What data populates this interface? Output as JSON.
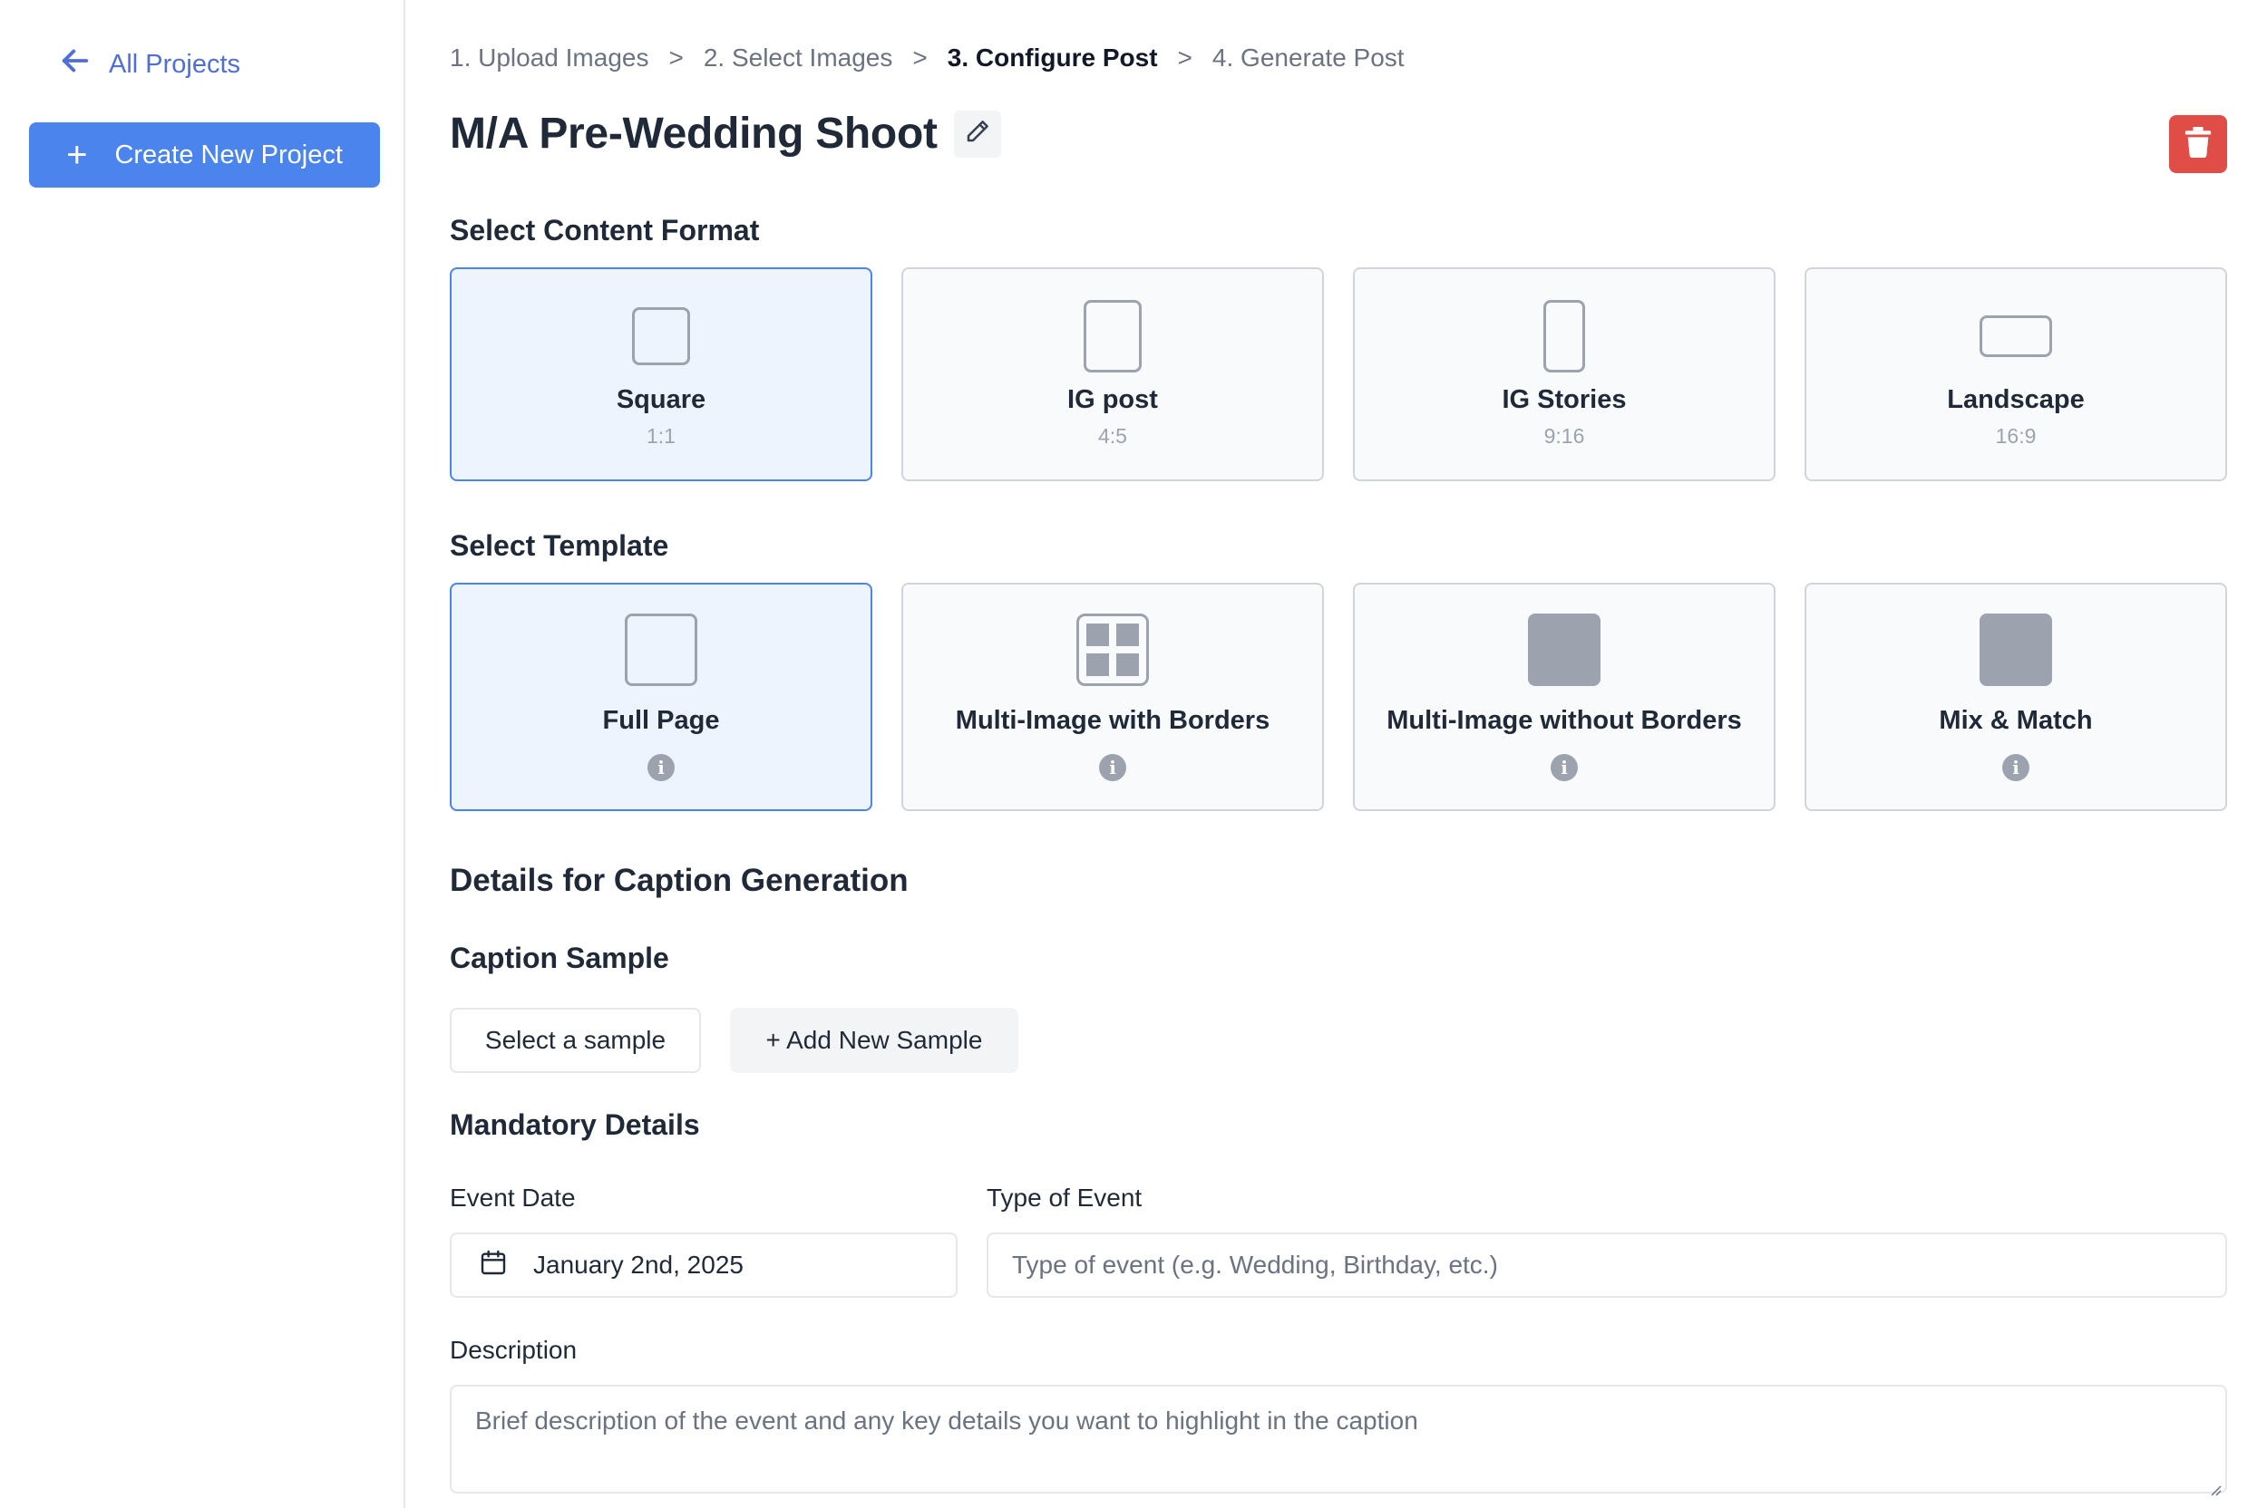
{
  "sidebar": {
    "back_label": "All Projects",
    "create_label": "Create New Project"
  },
  "breadcrumb": {
    "steps": [
      "1. Upload Images",
      "2. Select Images",
      "3. Configure Post",
      "4. Generate Post"
    ],
    "separator": ">",
    "active_index": 2
  },
  "project": {
    "title": "M/A Pre-Wedding Shoot"
  },
  "content_format": {
    "label": "Select Content Format",
    "options": [
      {
        "name": "Square",
        "ratio": "1:1",
        "selected": true
      },
      {
        "name": "IG post",
        "ratio": "4:5",
        "selected": false
      },
      {
        "name": "IG Stories",
        "ratio": "9:16",
        "selected": false
      },
      {
        "name": "Landscape",
        "ratio": "16:9",
        "selected": false
      }
    ]
  },
  "template": {
    "label": "Select Template",
    "options": [
      {
        "name": "Full Page",
        "selected": true
      },
      {
        "name": "Multi-Image with Borders",
        "selected": false
      },
      {
        "name": "Multi-Image without Borders",
        "selected": false
      },
      {
        "name": "Mix & Match",
        "selected": false
      }
    ]
  },
  "caption": {
    "heading": "Details for Caption Generation",
    "sample_label": "Caption Sample",
    "select_sample": "Select a sample",
    "add_sample": "+ Add New Sample"
  },
  "mandatory": {
    "heading": "Mandatory Details",
    "event_date_label": "Event Date",
    "event_date_value": "January 2nd, 2025",
    "event_type_label": "Type of Event",
    "event_type_placeholder": "Type of event (e.g. Wedding, Birthday, etc.)",
    "description_label": "Description",
    "description_placeholder": "Brief description of the event and any key details you want to highlight in the caption"
  },
  "colors": {
    "accent": "#4a84ec",
    "link": "#4f6ed8",
    "danger": "#e04c46",
    "selected_bg": "#eef4fe"
  }
}
